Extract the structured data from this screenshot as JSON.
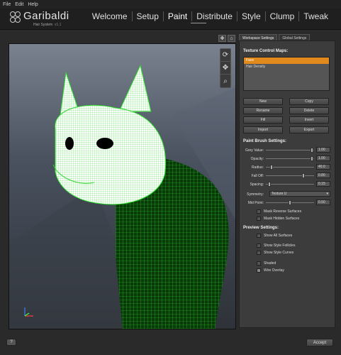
{
  "menu": [
    "File",
    "Edit",
    "Help"
  ],
  "app": {
    "title": "Garibaldi",
    "subtitle": "Hair System",
    "version": "v1.1"
  },
  "nav": [
    "Welcome",
    "Setup",
    "Paint",
    "Distribute",
    "Style",
    "Clump",
    "Tweak"
  ],
  "active_tab": "Paint",
  "panel_tabs": [
    "Workspace Settings",
    "Global Settings"
  ],
  "texture_maps": {
    "title": "Texture Control Maps:",
    "items": [
      "Face",
      "Hair Density"
    ],
    "selected": "Face"
  },
  "map_buttons": [
    "New",
    "Copy",
    "Rename",
    "Delete",
    "Fill",
    "Invert",
    "Import",
    "Export"
  ],
  "brush": {
    "title": "Paint Brush Settings:",
    "rows": [
      {
        "label": "Grey Value:",
        "value": "1.00",
        "level": 0.98
      },
      {
        "label": "Opacity:",
        "value": "1.00",
        "level": 0.98
      },
      {
        "label": "Radius:",
        "value": "40.0",
        "level": 0.1
      },
      {
        "label": "Fall Off:",
        "value": "0.80",
        "level": 0.8
      },
      {
        "label": "Spacing:",
        "value": "0.15",
        "level": 0.05
      }
    ],
    "symmetry_label": "Symmetry:",
    "symmetry_value": "Texture U",
    "midpoint_label": "Mid Point:",
    "midpoint_value": "0.50",
    "midpoint_level": 0.5,
    "mask_reverse": "Mask Reverse Surfaces",
    "mask_hidden": "Mask Hidden Surfaces"
  },
  "preview": {
    "title": "Preview Settings:",
    "items": [
      {
        "label": "Show All Surfaces",
        "checked": false
      },
      {
        "label": "Show Style Follicles",
        "checked": false
      },
      {
        "label": "Show Style Curves",
        "checked": false
      },
      {
        "label": "Shaded",
        "checked": false
      },
      {
        "label": "Wire Overlay",
        "checked": true
      }
    ]
  },
  "bottom": {
    "help": "?",
    "accept": "Accept"
  },
  "colors": {
    "accent": "#e08a1e",
    "wire": "#2bd62b"
  }
}
